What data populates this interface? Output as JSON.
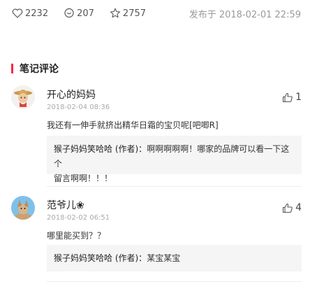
{
  "stats": {
    "likes": "2232",
    "comments": "207",
    "favorites": "2757",
    "published": "发布于 2018-02-01 22:59"
  },
  "section": {
    "title": "笔记评论"
  },
  "comments": [
    {
      "name": "开心的妈妈",
      "date": "2018-02-04 08:36",
      "likes": "1",
      "text": "我还有一伸手就挤出精华日霜的宝贝呢[吧唧R]",
      "reply": {
        "author": "猴子妈妈笑哈哈 (作者)：",
        "text_line1": "啊啊啊啊啊！哪家的品牌可以看一下这个",
        "text_line2": "留言啊啊！！！"
      }
    },
    {
      "name": "范爷儿❀",
      "date": "2018-02-02 06:51",
      "likes": "4",
      "text": "哪里能买到？？",
      "reply": {
        "author": "猴子妈妈笑哈哈 (作者)：",
        "text_line1": "某宝某宝"
      }
    }
  ],
  "colors": {
    "accent": "#ff2442"
  }
}
